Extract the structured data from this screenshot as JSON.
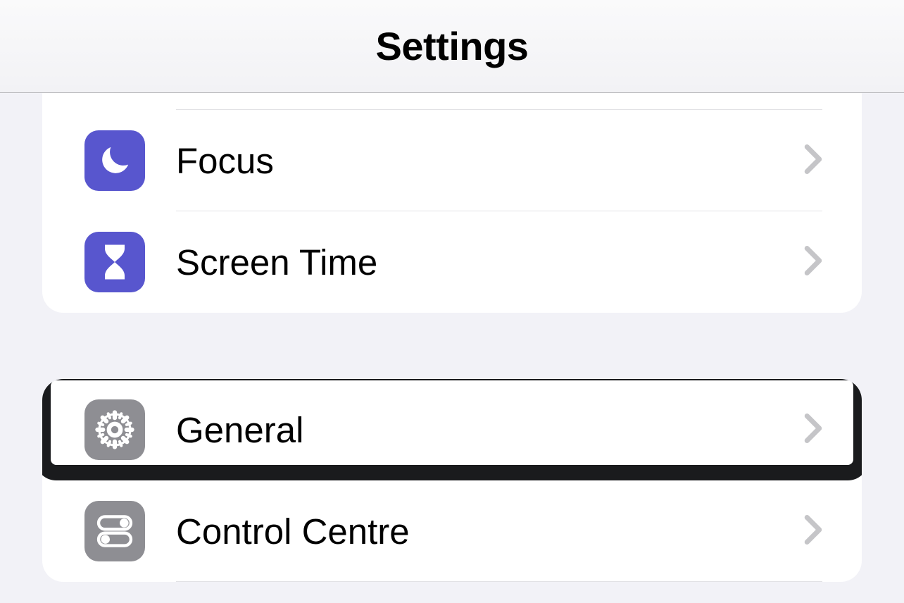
{
  "header": {
    "title": "Settings"
  },
  "group1": {
    "items": [
      {
        "label": "Focus",
        "icon": "moon-icon",
        "color": "purple"
      },
      {
        "label": "Screen Time",
        "icon": "hourglass-icon",
        "color": "purple"
      }
    ]
  },
  "group2": {
    "items": [
      {
        "label": "General",
        "icon": "gear-icon",
        "color": "gray",
        "highlighted": true
      },
      {
        "label": "Control Centre",
        "icon": "toggles-icon",
        "color": "gray"
      }
    ]
  }
}
